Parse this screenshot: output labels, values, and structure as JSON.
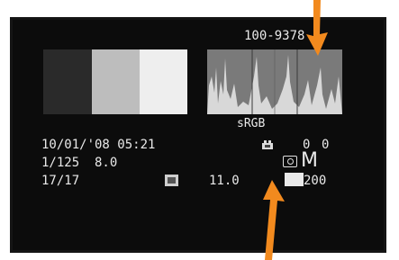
{
  "playback": {
    "folder_file": "100-9378",
    "color_space": "sRGB",
    "date_time": "10/01/'08 05:21",
    "exposure": "1/125  8.0",
    "frame_counter": "17/17",
    "file_size": "11.0",
    "iso": "200",
    "exposure_comp_1": "0",
    "exposure_comp_2": "0",
    "image_size": "M"
  },
  "icons": {
    "white_balance": "white-balance-icon",
    "flash": "flash-icon",
    "raw": "image-quality-icon",
    "arrows": "pointer-arrow-icon"
  },
  "colors": {
    "screen": "#0c0c0c",
    "text": "#e9e9e9",
    "arrow": "#f28a1e",
    "swatch_dark": "#2a2a2a",
    "swatch_mid": "#bdbdbd",
    "swatch_light": "#eeeeee"
  }
}
